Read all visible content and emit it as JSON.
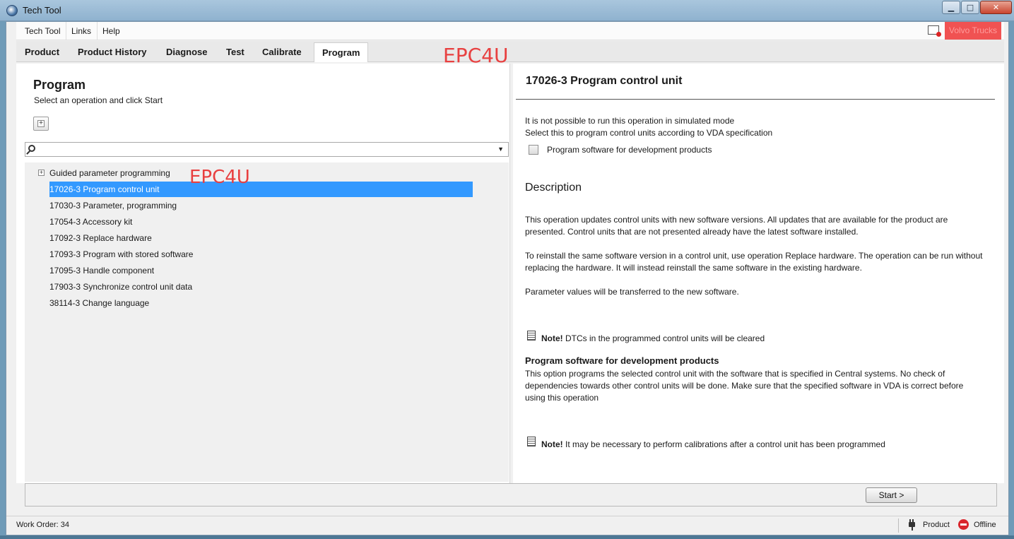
{
  "window": {
    "title": "Tech Tool",
    "min_glyph": "▁",
    "max_glyph": "□",
    "close_glyph": "✕"
  },
  "menu": {
    "items": [
      "Tech Tool",
      "Links",
      "Help"
    ],
    "brand": "Volvo Trucks"
  },
  "tabs": [
    "Product",
    "Product History",
    "Diagnose",
    "Test",
    "Calibrate",
    "Program"
  ],
  "active_tab": "Program",
  "watermark": "EPC4U",
  "left": {
    "title": "Program",
    "subtitle": "Select an operation and click Start",
    "expand_glyph": "+",
    "search": {
      "value": "",
      "dropdown_glyph": "▼"
    },
    "group": {
      "label": "Guided parameter programming",
      "glyph": "+"
    },
    "operations": [
      "17026-3 Program control unit",
      "17030-3 Parameter, programming",
      "17054-3 Accessory kit",
      "17092-3 Replace hardware",
      "17093-3 Program with stored software",
      "17095-3 Handle component",
      "17903-3 Synchronize control unit data",
      "38114-3 Change language"
    ],
    "selected_index": 0
  },
  "right": {
    "title": "17026-3 Program control unit",
    "sim_line1": "It is not possible to run this operation in simulated mode",
    "sim_line2": "Select this to program control units according to VDA specification",
    "checkbox_label": "Program software for development products",
    "desc_heading": "Description",
    "desc_p1": "This operation updates control units with new software versions. All updates that are available for the product are presented. Control units that are not presented already have the latest software installed.",
    "desc_p2": "To reinstall the same software version in a control unit, use operation Replace hardware. The operation can be run without replacing the hardware. It will instead reinstall the same software in the existing hardware.",
    "desc_p3": "Parameter values will be transferred to the new software.",
    "note_label": "Note!",
    "note1": "DTCs in the programmed control units will be cleared",
    "dev_heading": "Program software for development products",
    "dev_p": "This option programs the selected control unit with the software that is specified in Central systems. No check of dependencies towards other control units will be done. Make sure that the specified software in VDA is correct before using this operation",
    "note2": "It may be necessary to perform calibrations after a control unit has been programmed"
  },
  "actions": {
    "start_label": "Start >"
  },
  "status": {
    "work_order": "Work Order: 34",
    "product": "Product",
    "offline": "Offline"
  },
  "colors": {
    "selection": "#3399ff",
    "brand_badge": "#f05252",
    "offline": "#d9262c",
    "watermark": "#e84040"
  }
}
